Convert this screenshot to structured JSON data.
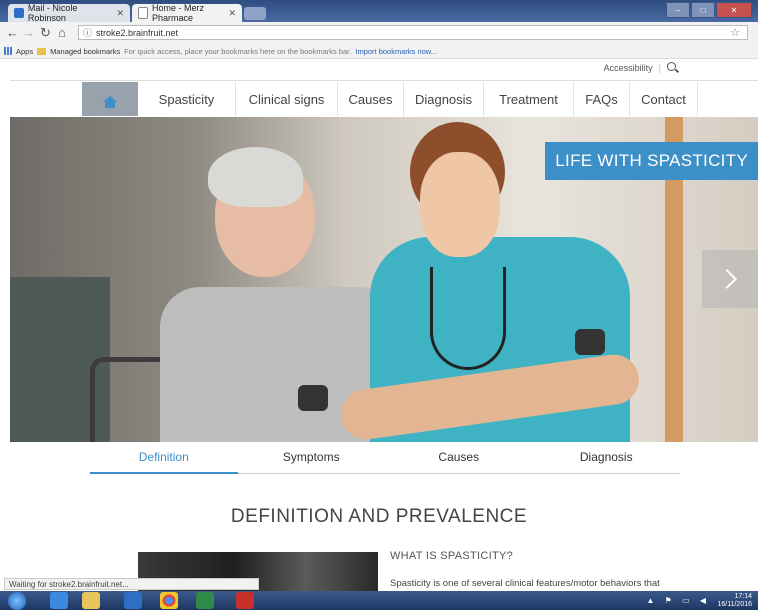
{
  "browser": {
    "tabs": [
      {
        "label": "Mail - Nicole Robinson",
        "active": false
      },
      {
        "label": "Home - Merz Pharmace",
        "active": true
      }
    ],
    "url": "stroke2.brainfruit.net",
    "bookmarks": {
      "apps": "Apps",
      "managed": "Managed bookmarks",
      "hint": "For quick access, place your bookmarks here on the bookmarks bar.",
      "import_link": "Import bookmarks now..."
    },
    "status": "Waiting for stroke2.brainfruit.net..."
  },
  "utility": {
    "accessibility": "Accessibility"
  },
  "nav": {
    "items": [
      "Spasticity",
      "Clinical signs",
      "Causes",
      "Diagnosis",
      "Treatment",
      "FAQs",
      "Contact"
    ]
  },
  "hero": {
    "title": "LIFE WITH SPASTICITY"
  },
  "subtabs": [
    "Definition",
    "Symptoms",
    "Causes",
    "Diagnosis"
  ],
  "section": {
    "title": "DEFINITION AND PREVALENCE",
    "subheading": "WHAT IS SPASTICITY?",
    "body": "Spasticity is one of several clinical features/motor behaviors that"
  },
  "taskbar": {
    "time": "17:14",
    "date": "16/11/2016"
  },
  "colors": {
    "accent": "#3d8fc7",
    "home_bg": "#98a2ad"
  }
}
